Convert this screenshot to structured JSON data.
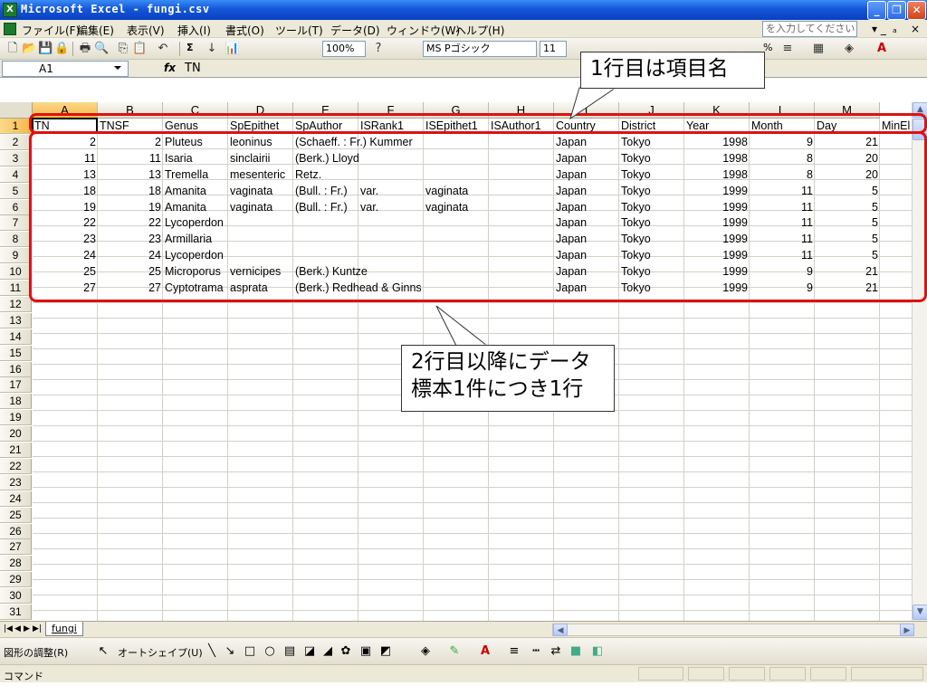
{
  "window": {
    "title": "Microsoft Excel - fungi.csv",
    "minimize": "_",
    "restore": "❐",
    "close": "✕"
  },
  "menu": [
    "ファイル(F)",
    "編集(E)",
    "表示(V)",
    "挿入(I)",
    "書式(O)",
    "ツール(T)",
    "データ(D)",
    "ウィンドウ(W)",
    "ヘルプ(H)"
  ],
  "help_box": {
    "placeholder": "を入力してください"
  },
  "toolbar": {
    "zoom": "100%",
    "font_name": "MS Pゴシック",
    "font_size": "11",
    "sum": "Σ",
    "percent": "%"
  },
  "formula_bar": {
    "name_box": "A1",
    "fx": "fx",
    "value": "TN"
  },
  "columns": [
    "A",
    "B",
    "C",
    "D",
    "E",
    "F",
    "G",
    "H",
    "I",
    "J",
    "K",
    "L",
    "M"
  ],
  "header_row": [
    "TN",
    "TNSF",
    "Genus",
    "SpEpithet",
    "SpAuthor",
    "ISRank1",
    "ISEpithet1",
    "ISAuthor1",
    "Country",
    "District",
    "Year",
    "Month",
    "Day",
    "MinEl"
  ],
  "rows": [
    {
      "tn": "2",
      "tnsf": "2",
      "genus": "Pluteus",
      "epithet": "leoninus",
      "author": "(Schaeff. : Fr.) Kummer",
      "rank": "",
      "isepithet": "",
      "country": "Japan",
      "district": "Tokyo",
      "year": "1998",
      "month": "9",
      "day": "21"
    },
    {
      "tn": "11",
      "tnsf": "11",
      "genus": "Isaria",
      "epithet": "sinclairii",
      "author": "(Berk.) Lloyd",
      "rank": "",
      "isepithet": "",
      "country": "Japan",
      "district": "Tokyo",
      "year": "1998",
      "month": "8",
      "day": "20"
    },
    {
      "tn": "13",
      "tnsf": "13",
      "genus": "Tremella",
      "epithet": "mesenteric",
      "author": "Retz.",
      "rank": "",
      "isepithet": "",
      "country": "Japan",
      "district": "Tokyo",
      "year": "1998",
      "month": "8",
      "day": "20"
    },
    {
      "tn": "18",
      "tnsf": "18",
      "genus": "Amanita",
      "epithet": "vaginata",
      "author": "(Bull. : Fr.)",
      "rank": "var.",
      "isepithet": "vaginata",
      "country": "Japan",
      "district": "Tokyo",
      "year": "1999",
      "month": "11",
      "day": "5"
    },
    {
      "tn": "19",
      "tnsf": "19",
      "genus": "Amanita",
      "epithet": "vaginata",
      "author": "(Bull. : Fr.)",
      "rank": "var.",
      "isepithet": "vaginata",
      "country": "Japan",
      "district": "Tokyo",
      "year": "1999",
      "month": "11",
      "day": "5"
    },
    {
      "tn": "22",
      "tnsf": "22",
      "genus": "Lycoperdon",
      "epithet": "",
      "author": "",
      "rank": "",
      "isepithet": "",
      "country": "Japan",
      "district": "Tokyo",
      "year": "1999",
      "month": "11",
      "day": "5"
    },
    {
      "tn": "23",
      "tnsf": "23",
      "genus": "Armillaria",
      "epithet": "",
      "author": "",
      "rank": "",
      "isepithet": "",
      "country": "Japan",
      "district": "Tokyo",
      "year": "1999",
      "month": "11",
      "day": "5"
    },
    {
      "tn": "24",
      "tnsf": "24",
      "genus": "Lycoperdon",
      "epithet": "",
      "author": "",
      "rank": "",
      "isepithet": "",
      "country": "Japan",
      "district": "Tokyo",
      "year": "1999",
      "month": "11",
      "day": "5"
    },
    {
      "tn": "25",
      "tnsf": "25",
      "genus": "Microporus",
      "epithet": "vernicipes",
      "author": "(Berk.) Kuntze",
      "rank": "",
      "isepithet": "",
      "country": "Japan",
      "district": "Tokyo",
      "year": "1999",
      "month": "9",
      "day": "21"
    },
    {
      "tn": "27",
      "tnsf": "27",
      "genus": "Cyptotrama",
      "epithet": "asprata",
      "author": "(Berk.) Redhead & Ginns",
      "rank": "",
      "isepithet": "",
      "country": "Japan",
      "district": "Tokyo",
      "year": "1999",
      "month": "9",
      "day": "21"
    }
  ],
  "row_numbers": [
    "1",
    "2",
    "3",
    "4",
    "5",
    "6",
    "7",
    "8",
    "9",
    "10",
    "11",
    "12",
    "13",
    "14",
    "15",
    "16",
    "17",
    "18",
    "19",
    "20",
    "21",
    "22",
    "23",
    "24",
    "25",
    "26",
    "27",
    "28",
    "29",
    "30",
    "31"
  ],
  "sheet_tab": "fungi",
  "drawing_toolbar": {
    "draw_menu": "図形の調整(R)",
    "autoshape_menu": "オートシェイプ(U)"
  },
  "status": "コマンド",
  "annotations": {
    "header_callout": "1行目は項目名",
    "data_callout_line1": "2行目以降にデータ",
    "data_callout_line2": "標本1件につき1行"
  },
  "colors": {
    "annotation": "#e01010",
    "titlebar": "#1457d8"
  }
}
